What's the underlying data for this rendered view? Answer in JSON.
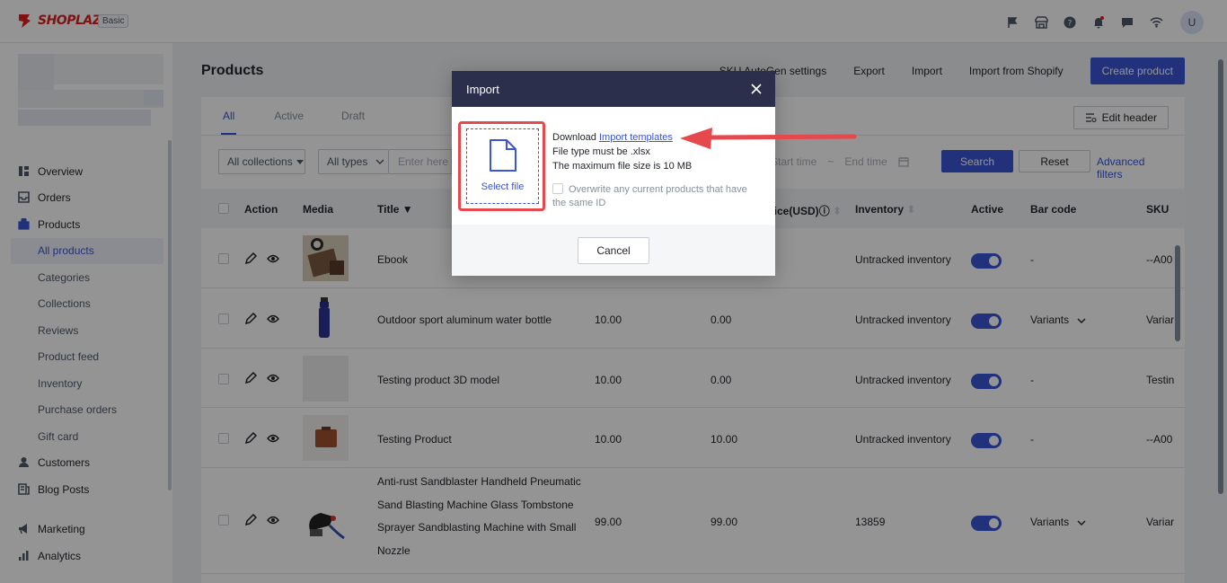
{
  "brand": {
    "name": "SHOPLAZZA",
    "plan": "Basic",
    "color": "#e02020"
  },
  "user": {
    "initial": "U"
  },
  "top_icons": [
    "flag-icon",
    "store-icon",
    "help-icon",
    "bell-icon",
    "chat-icon",
    "wifi-icon"
  ],
  "sidebar": {
    "items": [
      {
        "label": "Overview",
        "icon": "overview-icon",
        "type": "top"
      },
      {
        "label": "Orders",
        "icon": "orders-icon",
        "type": "top"
      },
      {
        "label": "Products",
        "icon": "products-icon",
        "type": "top"
      },
      {
        "label": "All products",
        "type": "sub",
        "active": true
      },
      {
        "label": "Categories",
        "type": "sub"
      },
      {
        "label": "Collections",
        "type": "sub"
      },
      {
        "label": "Reviews",
        "type": "sub"
      },
      {
        "label": "Product feed",
        "type": "sub"
      },
      {
        "label": "Inventory",
        "type": "sub"
      },
      {
        "label": "Purchase orders",
        "type": "sub"
      },
      {
        "label": "Gift card",
        "type": "sub"
      },
      {
        "label": "Customers",
        "icon": "customers-icon",
        "type": "top"
      },
      {
        "label": "Blog Posts",
        "icon": "blog-icon",
        "type": "top"
      },
      {
        "label": "Marketing",
        "icon": "marketing-icon",
        "type": "top"
      },
      {
        "label": "Analytics",
        "icon": "analytics-icon",
        "type": "top"
      }
    ]
  },
  "page": {
    "title": "Products",
    "actions": {
      "sku_autogen": "SKU AutoGen settings",
      "export": "Export",
      "import": "Import",
      "import_shopify": "Import from Shopify",
      "create": "Create product"
    }
  },
  "tabs": [
    "All",
    "Active",
    "Draft"
  ],
  "edit_header": "Edit header",
  "filters": {
    "collections": "All collections",
    "types": "All types",
    "search_placeholder": "Enter here",
    "start_time": "Start time",
    "range_sep": "~",
    "end_time": "End time",
    "search": "Search",
    "reset": "Reset",
    "advanced": "Advanced filters"
  },
  "table": {
    "headers": {
      "action": "Action",
      "media": "Media",
      "title": "Title",
      "price_partial": "rice(USD)",
      "inventory": "Inventory",
      "active": "Active",
      "barcode": "Bar code",
      "sku": "SKU"
    },
    "rows": [
      {
        "title": "Ebook",
        "price": "",
        "compare": "",
        "inventory": "Untracked inventory",
        "barcode": "-",
        "sku": "--A00"
      },
      {
        "title": "Outdoor sport aluminum water bottle",
        "price": "10.00",
        "compare": "0.00",
        "inventory": "Untracked inventory",
        "barcode": "Variants",
        "sku": "Variar"
      },
      {
        "title": "Testing product 3D model",
        "price": "10.00",
        "compare": "0.00",
        "inventory": "Untracked inventory",
        "barcode": "-",
        "sku": "Testin"
      },
      {
        "title": "Testing Product",
        "price": "10.00",
        "compare": "10.00",
        "inventory": "Untracked inventory",
        "barcode": "-",
        "sku": "--A00"
      },
      {
        "title": "Anti-rust Sandblaster Handheld Pneumatic Sand Blasting Machine Glass Tombstone Sprayer Sandblasting Machine with Small Nozzle",
        "price": "99.00",
        "compare": "99.00",
        "inventory": "13859",
        "barcode": "Variants",
        "sku": "Variar"
      }
    ]
  },
  "modal": {
    "title": "Import",
    "select_file": "Select file",
    "download_prefix": "Download",
    "download_link": "Import templates",
    "file_type": "File type must be .xlsx",
    "max_size": "The maximum file size is 10 MB",
    "overwrite": "Overwrite any current products that have the same ID",
    "cancel": "Cancel"
  },
  "colors": {
    "accent": "#3b55d6",
    "highlight": "#e5484d",
    "modal_header": "#2c2f4b"
  }
}
